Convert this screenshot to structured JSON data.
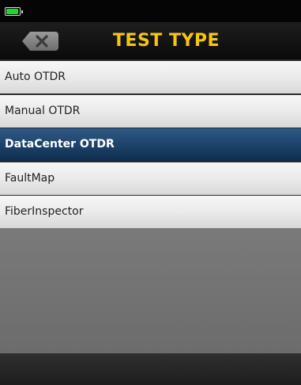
{
  "status_bar": {
    "battery_level": 1.0,
    "battery_color": "#22d33a"
  },
  "header": {
    "title": "TEST TYPE",
    "title_color": "#f4c418",
    "back_icon": "close-x-icon"
  },
  "menu": {
    "items": [
      {
        "label": "Auto OTDR",
        "selected": false
      },
      {
        "label": "Manual OTDR",
        "selected": false
      },
      {
        "label": "DataCenter OTDR",
        "selected": true
      },
      {
        "label": "FaultMap",
        "selected": false
      },
      {
        "label": "FiberInspector",
        "selected": false
      }
    ],
    "selected_color": "#1d4168"
  }
}
